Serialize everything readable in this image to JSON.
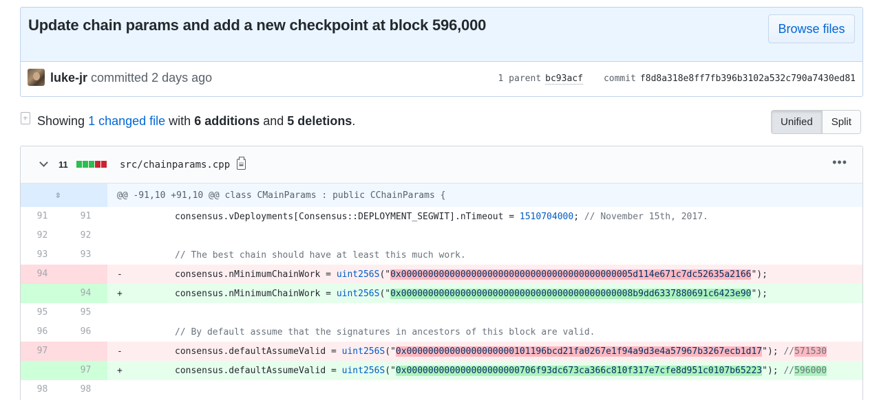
{
  "commit": {
    "title": "Update chain params and add a new checkpoint at block 596,000",
    "browse_files_label": "Browse files",
    "author": "luke-jr",
    "committed_text": "committed 2 days ago",
    "parent_label": "1 parent",
    "parent_sha": "bc93acf",
    "commit_label": "commit",
    "commit_sha": "f8d8a318e8ff7fb396b3102a532c790a7430ed81"
  },
  "toolbar": {
    "showing": "Showing",
    "changed_files": "1 changed file",
    "with": "with",
    "additions": "6 additions",
    "and": "and",
    "deletions": "5 deletions",
    "period": ".",
    "unified_label": "Unified",
    "split_label": "Split",
    "active_view": "Unified"
  },
  "file": {
    "change_count": "11",
    "diffstat": [
      "add",
      "add",
      "add",
      "del",
      "del"
    ],
    "path": "src/chainparams.cpp",
    "menu_glyph": "•••",
    "hunk_header": "@@ -91,10 +91,10 @@ class CMainParams : public CChainParams {",
    "hunk_icon": "expand-icon",
    "lines": [
      {
        "type": "ctx",
        "old": "91",
        "new": "91",
        "marker": "",
        "code_pre": "consensus.vDeployments[Consensus::DEPLOYMENT_SEGWIT].nTimeout = ",
        "num": "1510704000",
        "code_post": "; ",
        "comment": "// November 15th, 2017."
      },
      {
        "type": "ctx",
        "old": "92",
        "new": "92",
        "marker": ""
      },
      {
        "type": "ctx",
        "old": "93",
        "new": "93",
        "marker": "",
        "comment_only": "// The best chain should have at least this much work."
      },
      {
        "type": "del",
        "old": "94",
        "new": "",
        "marker": "-",
        "code_pre": "consensus.nMinimumChainWork = ",
        "fn": "uint256S",
        "q1": "(\"",
        "hex": "0x0000000000000000000000000000000000000000005d114e671c7dc52635a2166",
        "q2": "\");"
      },
      {
        "type": "add",
        "old": "",
        "new": "94",
        "marker": "+",
        "code_pre": "consensus.nMinimumChainWork = ",
        "fn": "uint256S",
        "q1": "(\"",
        "hex": "0x0000000000000000000000000000000000000000008b9dd6337880691c6423e90",
        "q2": "\");"
      },
      {
        "type": "ctx",
        "old": "95",
        "new": "95",
        "marker": ""
      },
      {
        "type": "ctx",
        "old": "96",
        "new": "96",
        "marker": "",
        "comment_only": "// By default assume that the signatures in ancestors of this block are valid."
      },
      {
        "type": "del",
        "old": "97",
        "new": "",
        "marker": "-",
        "code_pre": "consensus.defaultAssumeValid = ",
        "fn": "uint256S",
        "q1": "(\"",
        "hex": "0x00000000000000000000101196bcd21fa0267e1f94a9d3e4a57967b3267ecb1d17",
        "q2": "\"); ",
        "tail_comment": "//",
        "tail_hl": "571530"
      },
      {
        "type": "add",
        "old": "",
        "new": "97",
        "marker": "+",
        "code_pre": "consensus.defaultAssumeValid = ",
        "fn": "uint256S",
        "q1": "(\"",
        "hex": "0x000000000000000000000706f93dc673ca366c810f317e7cfe8d951c0107b65223",
        "q2": "\"); ",
        "tail_comment": "//",
        "tail_hl": "596000"
      },
      {
        "type": "ctx",
        "old": "98",
        "new": "98",
        "marker": ""
      }
    ]
  },
  "colors": {
    "accent": "#0366d6",
    "add_bg": "#e6ffed",
    "add_hl": "#acf2bd",
    "del_bg": "#ffeef0",
    "del_hl": "#fdb8c0"
  }
}
